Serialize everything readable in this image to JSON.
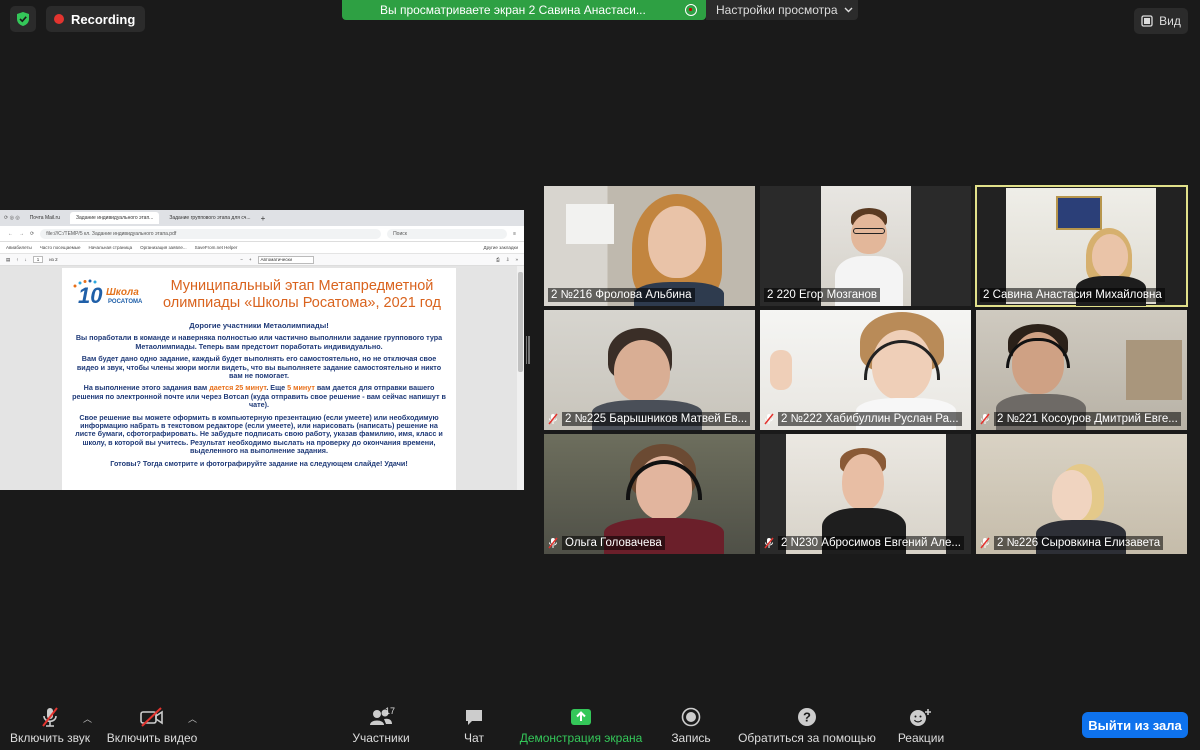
{
  "top": {
    "recording_label": "Recording",
    "share_banner": "Вы просматриваете экран 2 Савина Анастаси...",
    "view_settings": "Настройки просмотра",
    "view_button": "Вид"
  },
  "shared_screen": {
    "browser": {
      "tabs": [
        "Почта Mail.ru",
        "Задание индивидуального этап...",
        "Задание группового этапа для сч..."
      ],
      "address": "file:///C:/TEMP/5 кл. Задание индивидуального этапа.pdf",
      "search_placeholder": "Поиск",
      "bookmarks": [
        "Авиабилеты",
        "Часто посещаемые",
        "Начальная страница",
        "Организация заявле...",
        "SaveFrom.net Helper"
      ],
      "other_bookmarks": "Другие закладки",
      "page_num": "1",
      "page_total": "из 2",
      "zoom": "Автоматически"
    },
    "pdf": {
      "logo_text": "Школа",
      "logo_sub": "РОСАТОМА",
      "logo_number": "10",
      "title_line1": "Муниципальный этап Метапредметной",
      "title_line2": "олимпиады «Школы Росатома», 2021 год",
      "greeting": "Дорогие участники Метаолимпиады!",
      "p1": "Вы поработали в команде и наверняка полностью или частично выполнили задание группового тура Метаолимпиады. Теперь вам предстоит поработать индивидуально.",
      "p2": "Вам будет дано одно задание, каждый будет выполнять его самостоятельно, но не отключая свое видео и звук, чтобы члены жюри могли видеть, что вы выполняете задание самостоятельно и никто вам не помогает.",
      "p3_a": "На выполнение этого задания вам ",
      "p3_b": "дается 25 минут",
      "p3_c": ". Еще ",
      "p3_d": "5 минут",
      "p3_e": " вам дается для отправки вашего решения по электронной почте или через Вотсап (куда отправить свое решение - вам сейчас напишут в чате).",
      "p4": "Свое решение вы можете оформить в компьютерную презентацию (если умеете) или необходимую информацию набрать в текстовом редакторе (если умеете), или нарисовать (написать) решение на листе бумаги, сфотографировать. Не забудьте подписать свою работу, указав фамилию, имя, класс и школу, в которой вы учитесь. Результат необходимо выслать на проверку до окончания времени, выделенного на выполнение задания.",
      "p5": "Готовы? Тогда смотрите и фотографируйте задание на следующем слайде! Удачи!"
    }
  },
  "participants": [
    {
      "name": "2 №216 Фролова Альбина",
      "muted": false
    },
    {
      "name": "2 220 Егор Мозганов",
      "muted": false
    },
    {
      "name": "2 Савина Анастасия Михайловна",
      "muted": false
    },
    {
      "name": "2 №225 Барышников Матвей Ев...",
      "muted": true
    },
    {
      "name": "2 №222 Хабибуллин Руслан Ра...",
      "muted": true
    },
    {
      "name": "2 №221 Косоуров Дмитрий Евге...",
      "muted": true
    },
    {
      "name": "Ольга Головачева",
      "muted": true
    },
    {
      "name": "2 N230 Абросимов Евгений Але...",
      "muted": true
    },
    {
      "name": "2 №226 Сыровкина Елизавета",
      "muted": true
    }
  ],
  "toolbar": {
    "unmute": "Включить звук",
    "start_video": "Включить видео",
    "participants": "Участники",
    "participants_count": "17",
    "chat": "Чат",
    "share": "Демонстрация экрана",
    "record": "Запись",
    "help": "Обратиться за помощью",
    "reactions": "Реакции",
    "leave": "Выйти из зала"
  },
  "colors": {
    "share_green": "#2ea043",
    "leave_blue": "#0e72ed",
    "active_speaker": "#e1e08a",
    "title_orange": "#d9631e",
    "text_navy": "#1f3a78"
  }
}
